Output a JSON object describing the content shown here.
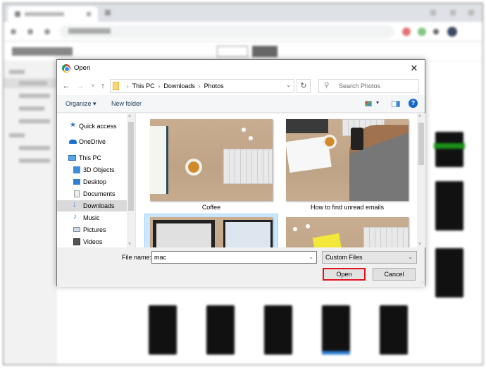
{
  "background": {
    "description": "blurred browser window showing photo library",
    "accent_colors": {
      "red_ext": "#e57373",
      "green_ext": "#81c784",
      "avatar": "#3d4a63",
      "selected_green": "#1a8f1a",
      "selected_blue": "#2b7fd6"
    }
  },
  "dialog": {
    "title": "Open",
    "close_glyph": "✕",
    "nav": {
      "back_glyph": "←",
      "forward_glyph": "→",
      "recent_glyph": "˅",
      "up_glyph": "↑",
      "breadcrumb": [
        "This PC",
        "Downloads",
        "Photos"
      ],
      "breadcrumb_sep": "›",
      "dropdown_glyph": "⌄",
      "refresh_glyph": "↻"
    },
    "search": {
      "placeholder": "Search Photos",
      "icon_glyph": "⚲"
    },
    "toolbar": {
      "organize_label": "Organize ▾",
      "new_folder_label": "New folder",
      "view_dd_glyph": "▾",
      "help_glyph": "?"
    },
    "nav_pane": {
      "items": [
        {
          "label": "Quick access",
          "icon": "star-icon",
          "selected": false
        },
        {
          "label": "OneDrive",
          "icon": "cloud-icon",
          "selected": false
        },
        {
          "label": "This PC",
          "icon": "computer-icon",
          "selected": false
        },
        {
          "label": "3D Objects",
          "icon": "cube-icon",
          "selected": false
        },
        {
          "label": "Desktop",
          "icon": "desktop-icon",
          "selected": false
        },
        {
          "label": "Documents",
          "icon": "document-icon",
          "selected": false
        },
        {
          "label": "Downloads",
          "icon": "download-icon",
          "selected": true
        },
        {
          "label": "Music",
          "icon": "music-icon",
          "selected": false
        },
        {
          "label": "Pictures",
          "icon": "pictures-icon",
          "selected": false
        },
        {
          "label": "Videos",
          "icon": "video-icon",
          "selected": false
        }
      ],
      "scroll_up": "˄",
      "scroll_down": "˅"
    },
    "files": [
      {
        "label": "Coffee",
        "selected": false
      },
      {
        "label": "How to find unread emails",
        "selected": false
      },
      {
        "label": "",
        "selected": true
      },
      {
        "label": "",
        "selected": false
      }
    ],
    "content_scroll": {
      "up": "˄",
      "down": "˅"
    },
    "file_name_label": "File name:",
    "file_name_value": "mac",
    "file_name_dd": "⌄",
    "file_type_value": "Custom Files",
    "file_type_dd": "⌄",
    "open_label": "Open",
    "cancel_label": "Cancel",
    "highlight_color": "#e0141e"
  }
}
